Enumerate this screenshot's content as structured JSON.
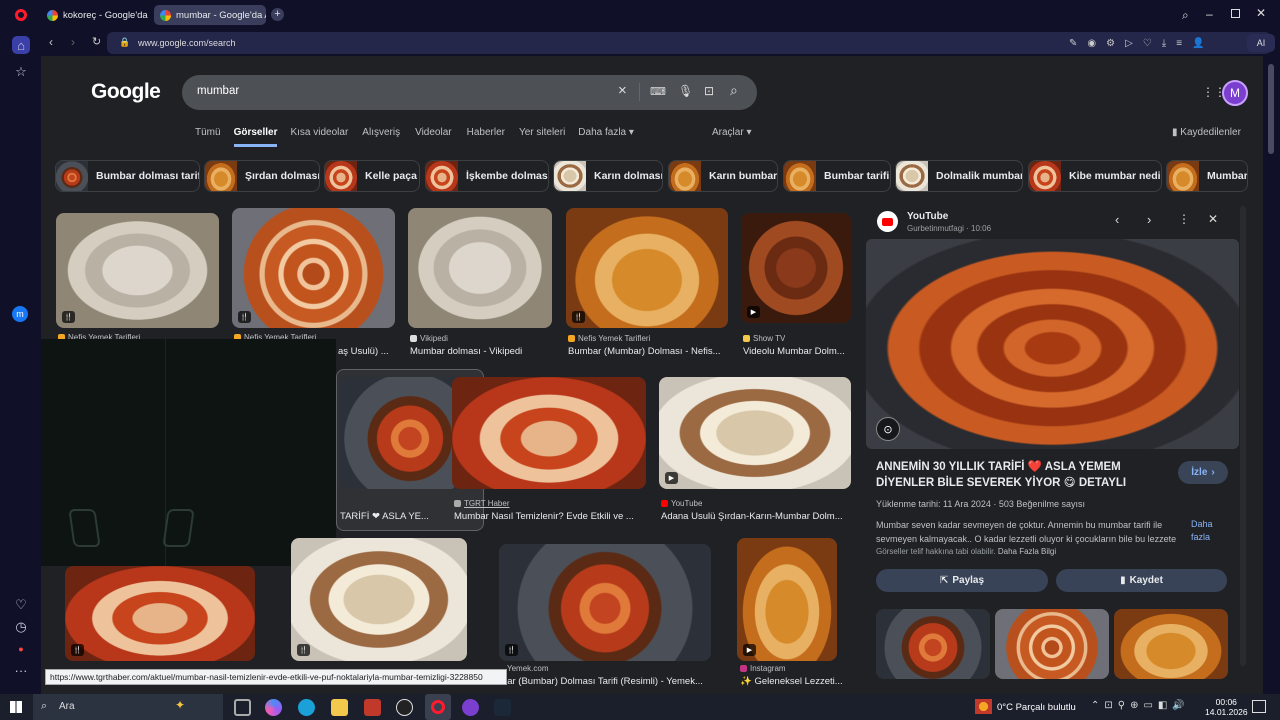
{
  "tabs": [
    {
      "label": "kokoreç - Google'da Ara",
      "active": false
    },
    {
      "label": "mumbar - Google'da Ara",
      "active": true
    }
  ],
  "url": "www.google.com/search",
  "ai_label": "AI",
  "google_logo": "Google",
  "search": {
    "query": "mumbar"
  },
  "avatar_initial": "M",
  "nav": {
    "items": [
      "Tümü",
      "Görseller",
      "Kısa videolar",
      "Alışveriş",
      "Videolar",
      "Haberler",
      "Yer siteleri",
      "Daha fazla"
    ],
    "active": "Görseller",
    "tools": "Araçlar",
    "saved": "Kaydedilenler"
  },
  "chips": [
    "Bumbar dolması tarifi",
    "Şırdan dolması",
    "Kelle paça",
    "İşkembe dolması",
    "Karın dolması",
    "Karın bumbar",
    "Bumbar tarifi",
    "Dolmalik mumbar",
    "Kibe mumbar nedir",
    "Mumbar"
  ],
  "results": {
    "r1": {
      "source": "Nefis Yemek Tarifleri",
      "title": ""
    },
    "r2": {
      "source": "Nefis Yemek Tarifleri",
      "title": "aş Usulü) ..."
    },
    "r3": {
      "source": "Vikipedi",
      "title": "Mumbar dolması - Vikipedi"
    },
    "r4": {
      "source": "Nefis Yemek Tarifleri",
      "title": "Bumbar (Mumbar) Dolması - Nefis..."
    },
    "r5": {
      "source": "Show TV",
      "title": "Videolu Mumbar Dolm..."
    },
    "r6": {
      "source": "",
      "title": "TARİFİ ❤ ASLA YE..."
    },
    "r7": {
      "source": "TGRT Haber",
      "title": "Mumbar Nasıl Temizlenir? Evde Etkili ve ..."
    },
    "r8": {
      "source": "YouTube",
      "title": "Adana Usulü Şırdan-Karın-Mumbar Dolm..."
    },
    "r9": {
      "source": "Yemek.com",
      "title": "mbar (Bumbar) Dolması Tarifi (Resimli) - Yemek..."
    },
    "r10": {
      "source": "Instagram",
      "title": "✨ Geleneksel Lezzeti..."
    }
  },
  "panel": {
    "source": "YouTube",
    "channel": "Gurbetinmutfagi · 10:06",
    "title": "ANNEMİN 30 YILLIK TARİFİ ❤️ ASLA YEMEM DİYENLER BİLE SEVEREK YİYOR 😋 DETAYLI MUMBAR DOLMASI...",
    "watch": "İzle",
    "meta": "Yüklenme tarihi: 11 Ara 2024 · 503 Beğenilme sayısı",
    "desc": "Mumbar seven kadar sevmeyen de çoktur. Annemin bu mumbar tarifi ile sevmeyen kalmayacak.. O kadar lezzetli oluyor ki çocukların bile bu lezzete",
    "more": "Daha fazla",
    "copyright": "Görseller telif hakkına tabi olabilir.",
    "more_info": "Daha Fazla Bilgi",
    "share": "Paylaş",
    "save": "Kaydet"
  },
  "status_url": "https://www.tgrthaber.com/aktuel/mumbar-nasil-temizlenir-evde-etkili-ve-puf-noktalariyla-mumbar-temizligi-3228850",
  "taskbar": {
    "search": "Ara",
    "weather": "0°C  Parçalı bulutlu",
    "time": "00:06",
    "date": "14.01.2026"
  },
  "colors": {
    "accent": "#8ab4f8",
    "page_bg": "#202124",
    "browser_bg": "#101128"
  }
}
